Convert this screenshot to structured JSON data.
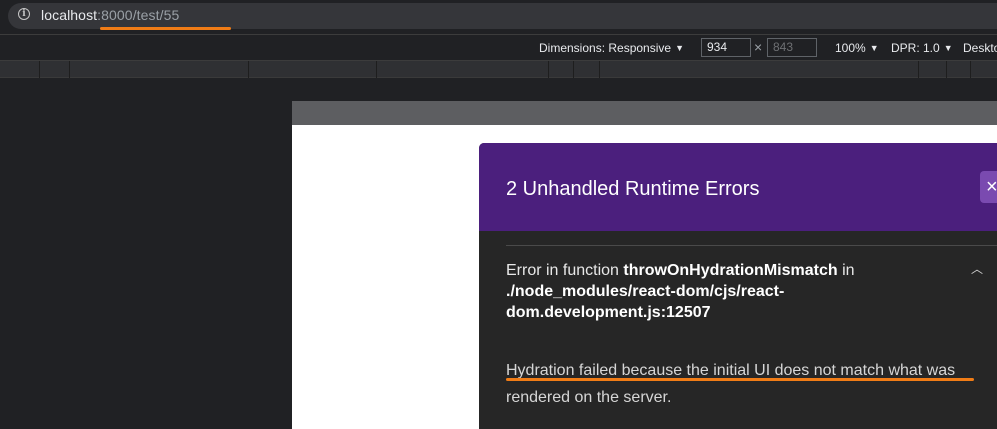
{
  "address_bar": {
    "host": "localhost",
    "path": ":8000/test/55"
  },
  "devtools_toolbar": {
    "dimensions_label": "Dimensions: Responsive",
    "width_value": "934",
    "height_placeholder": "843",
    "times_symbol": "×",
    "zoom": "100%",
    "dpr": "DPR: 1.0",
    "device_mode": "Deskto"
  },
  "error_overlay": {
    "title": "2 Unhandled Runtime Errors",
    "close_symbol": "×",
    "location_prefix": "Error in function ",
    "function_name": "throwOnHydrationMismatch",
    "location_in": " in",
    "file_path": "./node_modules/react-dom/cjs/react-dom.development.js:12507",
    "message": "Hydration failed because the initial UI does not match what was rendered on the server."
  },
  "colors": {
    "overlay_header": "#4b1f7d",
    "overlay_body": "#262626",
    "annotation_underline": "#f07c16",
    "browser_chrome": "#202124"
  },
  "icons": {
    "address_bar": "info-icon",
    "collapse": "chevron-up-icon",
    "dropdown": "caret-down-icon",
    "dismiss": "close-icon"
  }
}
